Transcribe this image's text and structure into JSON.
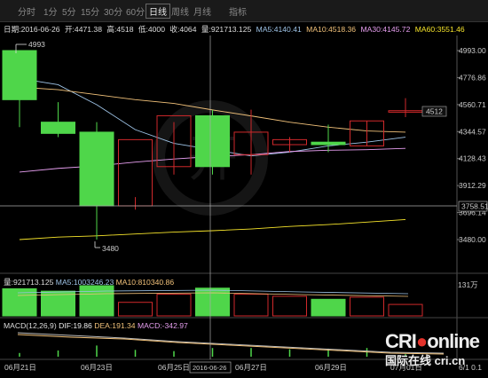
{
  "tabs": [
    {
      "label": "分时",
      "active": false
    },
    {
      "label": "1分",
      "active": false
    },
    {
      "label": "5分",
      "active": false
    },
    {
      "label": "15分",
      "active": false
    },
    {
      "label": "30分",
      "active": false
    },
    {
      "label": "60分",
      "active": false
    },
    {
      "label": "日线",
      "active": true
    },
    {
      "label": "周线",
      "active": false
    },
    {
      "label": "月线",
      "active": false
    },
    {
      "label": "指标",
      "active": false
    }
  ],
  "info": {
    "date": "日期:2016-06-26",
    "open": "开:4471.38",
    "high": "高:4518",
    "low": "低:4000",
    "close": "收:4064",
    "volume": "量:921713.125",
    "ma5": "MA5:4140.41",
    "ma10": "MA10:4518.36",
    "ma30": "MA30:4145.72",
    "ma60": "MA60:3551.46"
  },
  "price_axis": [
    "4993.00",
    "4776.86",
    "4560.71",
    "4344.57",
    "4128.43",
    "3912.29",
    "3696.14",
    "3480.00"
  ],
  "cursor_price": "3758.51",
  "last_price": "4512",
  "high_mark": "4993",
  "low_mark": "3480",
  "volinfo": {
    "vol": "量:921713.125",
    "ma5": "MA5:1003246.23",
    "ma10": "MA10:810340.86"
  },
  "vol_axis": "131万",
  "macdinfo": {
    "label": "MACD(12,26,9)",
    "dif": "DIF:19.86",
    "dea": "DEA:191.34",
    "macd": "MACD:-342.97"
  },
  "dates": [
    "06月21日",
    "06月23日",
    "06月25日",
    "2016-06-26",
    "06月27日",
    "06月29日",
    "07月01日"
  ],
  "right_date": "6/1 0.1",
  "logo": {
    "brand": "CRI",
    "brand2": "online",
    "sub": "国际在线 cri.cn"
  },
  "chart_data": {
    "type": "candlestick",
    "x": [
      "06-21",
      "06-22",
      "06-23",
      "06-24",
      "06-25",
      "06-26",
      "06-27",
      "06-28",
      "06-29",
      "06-30",
      "07-01"
    ],
    "open": [
      4993,
      4420,
      4340,
      3750,
      4064,
      4471.38,
      4160,
      4240,
      4260,
      4230,
      4500
    ],
    "high": [
      4993,
      4580,
      4420,
      3820,
      4420,
      4518,
      4520,
      4300,
      4400,
      4430,
      4612
    ],
    "low": [
      4380,
      4300,
      3480,
      3720,
      4000,
      4000,
      4000,
      4180,
      4180,
      4230,
      4460
    ],
    "close": [
      4600,
      4330,
      3750,
      4280,
      4471.38,
      4064,
      4340,
      4280,
      4240,
      4430,
      4512
    ],
    "up": [
      false,
      false,
      false,
      true,
      true,
      false,
      true,
      true,
      false,
      true,
      true
    ],
    "ma5": [
      4770,
      4720,
      4560,
      4360,
      4250,
      4200,
      4150,
      4180,
      4230,
      4260,
      4300
    ],
    "ma10": [
      4700,
      4680,
      4640,
      4600,
      4570,
      4518,
      4470,
      4420,
      4380,
      4350,
      4340
    ],
    "ma30": [
      4020,
      4050,
      4070,
      4100,
      4125,
      4145,
      4160,
      4185,
      4195,
      4200,
      4210
    ],
    "ma60": [
      3480,
      3500,
      3510,
      3525,
      3540,
      3551,
      3565,
      3585,
      3600,
      3620,
      3640
    ],
    "volume_ratio": [
      0.9,
      0.82,
      1.0,
      0.45,
      0.72,
      0.92,
      0.72,
      0.65,
      0.55,
      0.62,
      0.38
    ],
    "macd_hist_ratio": [
      0.3,
      0.5,
      0.9,
      0.55,
      0.45,
      0.7,
      0.7,
      0.6,
      0.65,
      0.7,
      0.2
    ]
  }
}
